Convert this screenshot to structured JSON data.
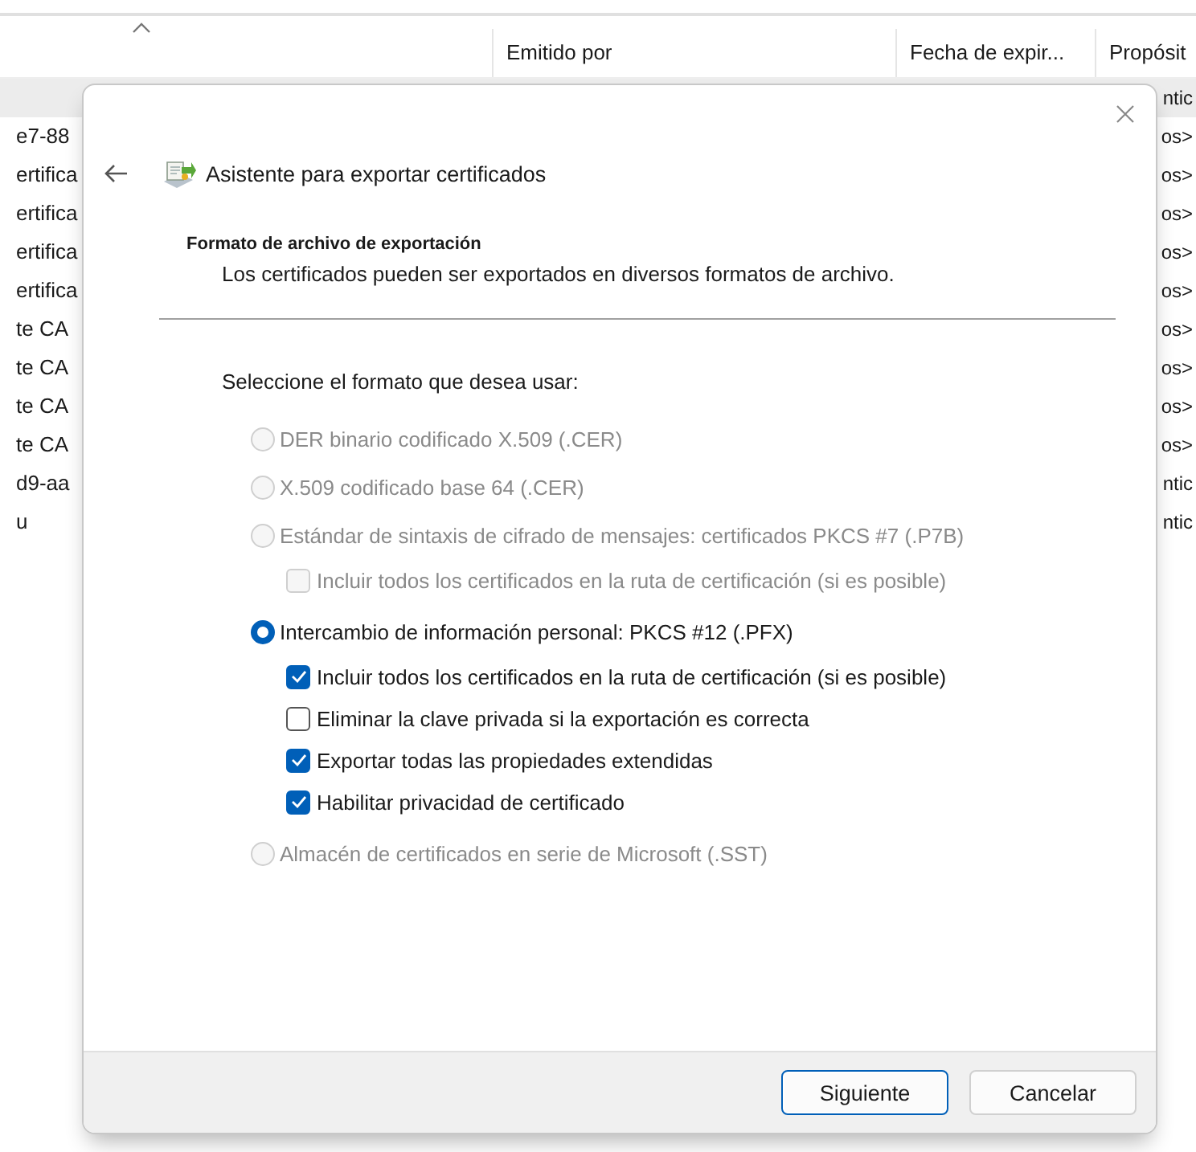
{
  "background_list": {
    "columns": [
      {
        "label": "Emitido por"
      },
      {
        "label": "Fecha de expir..."
      },
      {
        "label": "Propósit"
      }
    ],
    "rows": [
      {
        "column_1": "",
        "column_4": "ntic",
        "selected": true
      },
      {
        "column_1": "e7-88",
        "column_4": "os>",
        "selected": false
      },
      {
        "column_1": "ertifica",
        "column_4": "os>",
        "selected": false
      },
      {
        "column_1": "ertifica",
        "column_4": "os>",
        "selected": false
      },
      {
        "column_1": "ertifica",
        "column_4": "os>",
        "selected": false
      },
      {
        "column_1": "ertifica",
        "column_4": "os>",
        "selected": false
      },
      {
        "column_1": "te CA",
        "column_4": "os>",
        "selected": false
      },
      {
        "column_1": "te CA",
        "column_4": "os>",
        "selected": false
      },
      {
        "column_1": "te CA",
        "column_4": "os>",
        "selected": false
      },
      {
        "column_1": "te CA",
        "column_4": "os>",
        "selected": false
      },
      {
        "column_1": "d9-aa",
        "column_4": "ntic",
        "selected": false
      },
      {
        "column_1": "u",
        "column_4": "ntic",
        "selected": false
      }
    ]
  },
  "dialog": {
    "title": "Asistente para exportar certificados",
    "section_title": "Formato de archivo de exportación",
    "section_subtitle": "Los certificados pueden ser exportados en diversos formatos de archivo.",
    "prompt": "Seleccione el formato que desea usar:",
    "options": [
      {
        "kind": "radio",
        "label": "DER binario codificado X.509 (.CER)",
        "selected": false,
        "disabled": true
      },
      {
        "kind": "radio",
        "label": "X.509 codificado base 64 (.CER)",
        "selected": false,
        "disabled": true
      },
      {
        "kind": "radio",
        "label": "Estándar de sintaxis de cifrado de mensajes: certificados PKCS #7 (.P7B)",
        "selected": false,
        "disabled": true,
        "children": [
          {
            "kind": "checkbox",
            "label": "Incluir todos los certificados en la ruta de certificación (si es posible)",
            "checked": false,
            "disabled": true
          }
        ]
      },
      {
        "kind": "radio",
        "label": "Intercambio de información personal: PKCS #12 (.PFX)",
        "selected": true,
        "disabled": false,
        "children": [
          {
            "kind": "checkbox",
            "label": "Incluir todos los certificados en la ruta de certificación (si es posible)",
            "checked": true,
            "disabled": false
          },
          {
            "kind": "checkbox",
            "label": "Eliminar la clave privada si la exportación es correcta",
            "checked": false,
            "disabled": false
          },
          {
            "kind": "checkbox",
            "label": "Exportar todas las propiedades extendidas",
            "checked": true,
            "disabled": false
          },
          {
            "kind": "checkbox",
            "label": "Habilitar privacidad de certificado",
            "checked": true,
            "disabled": false
          }
        ]
      },
      {
        "kind": "radio",
        "label": "Almacén de certificados en serie de Microsoft (.SST)",
        "selected": false,
        "disabled": true
      }
    ],
    "buttons": [
      {
        "label": "Siguiente",
        "default": true
      },
      {
        "label": "Cancelar",
        "default": false
      }
    ]
  }
}
